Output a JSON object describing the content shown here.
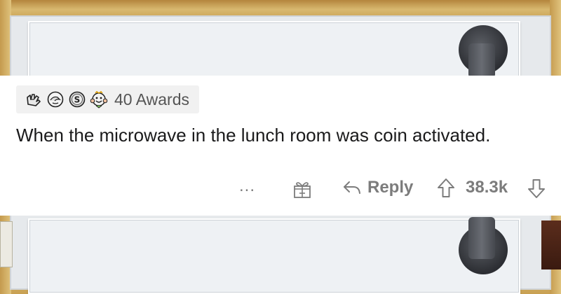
{
  "comment": {
    "awards": {
      "icons": [
        "shaka-award-icon",
        "facepalm-award-icon",
        "silver-coin-award-icon",
        "wholesome-award-icon"
      ],
      "label": "40 Awards"
    },
    "text": "When the microwave in the lunch room was coin activated.",
    "actions": {
      "more_label": "...",
      "reply_label": "Reply",
      "score": "38.3k"
    }
  },
  "colors": {
    "text": "#1a1a1b",
    "muted": "#7c7c7c",
    "award_bg": "#f1f1f1",
    "card_bg": "#ffffff"
  }
}
